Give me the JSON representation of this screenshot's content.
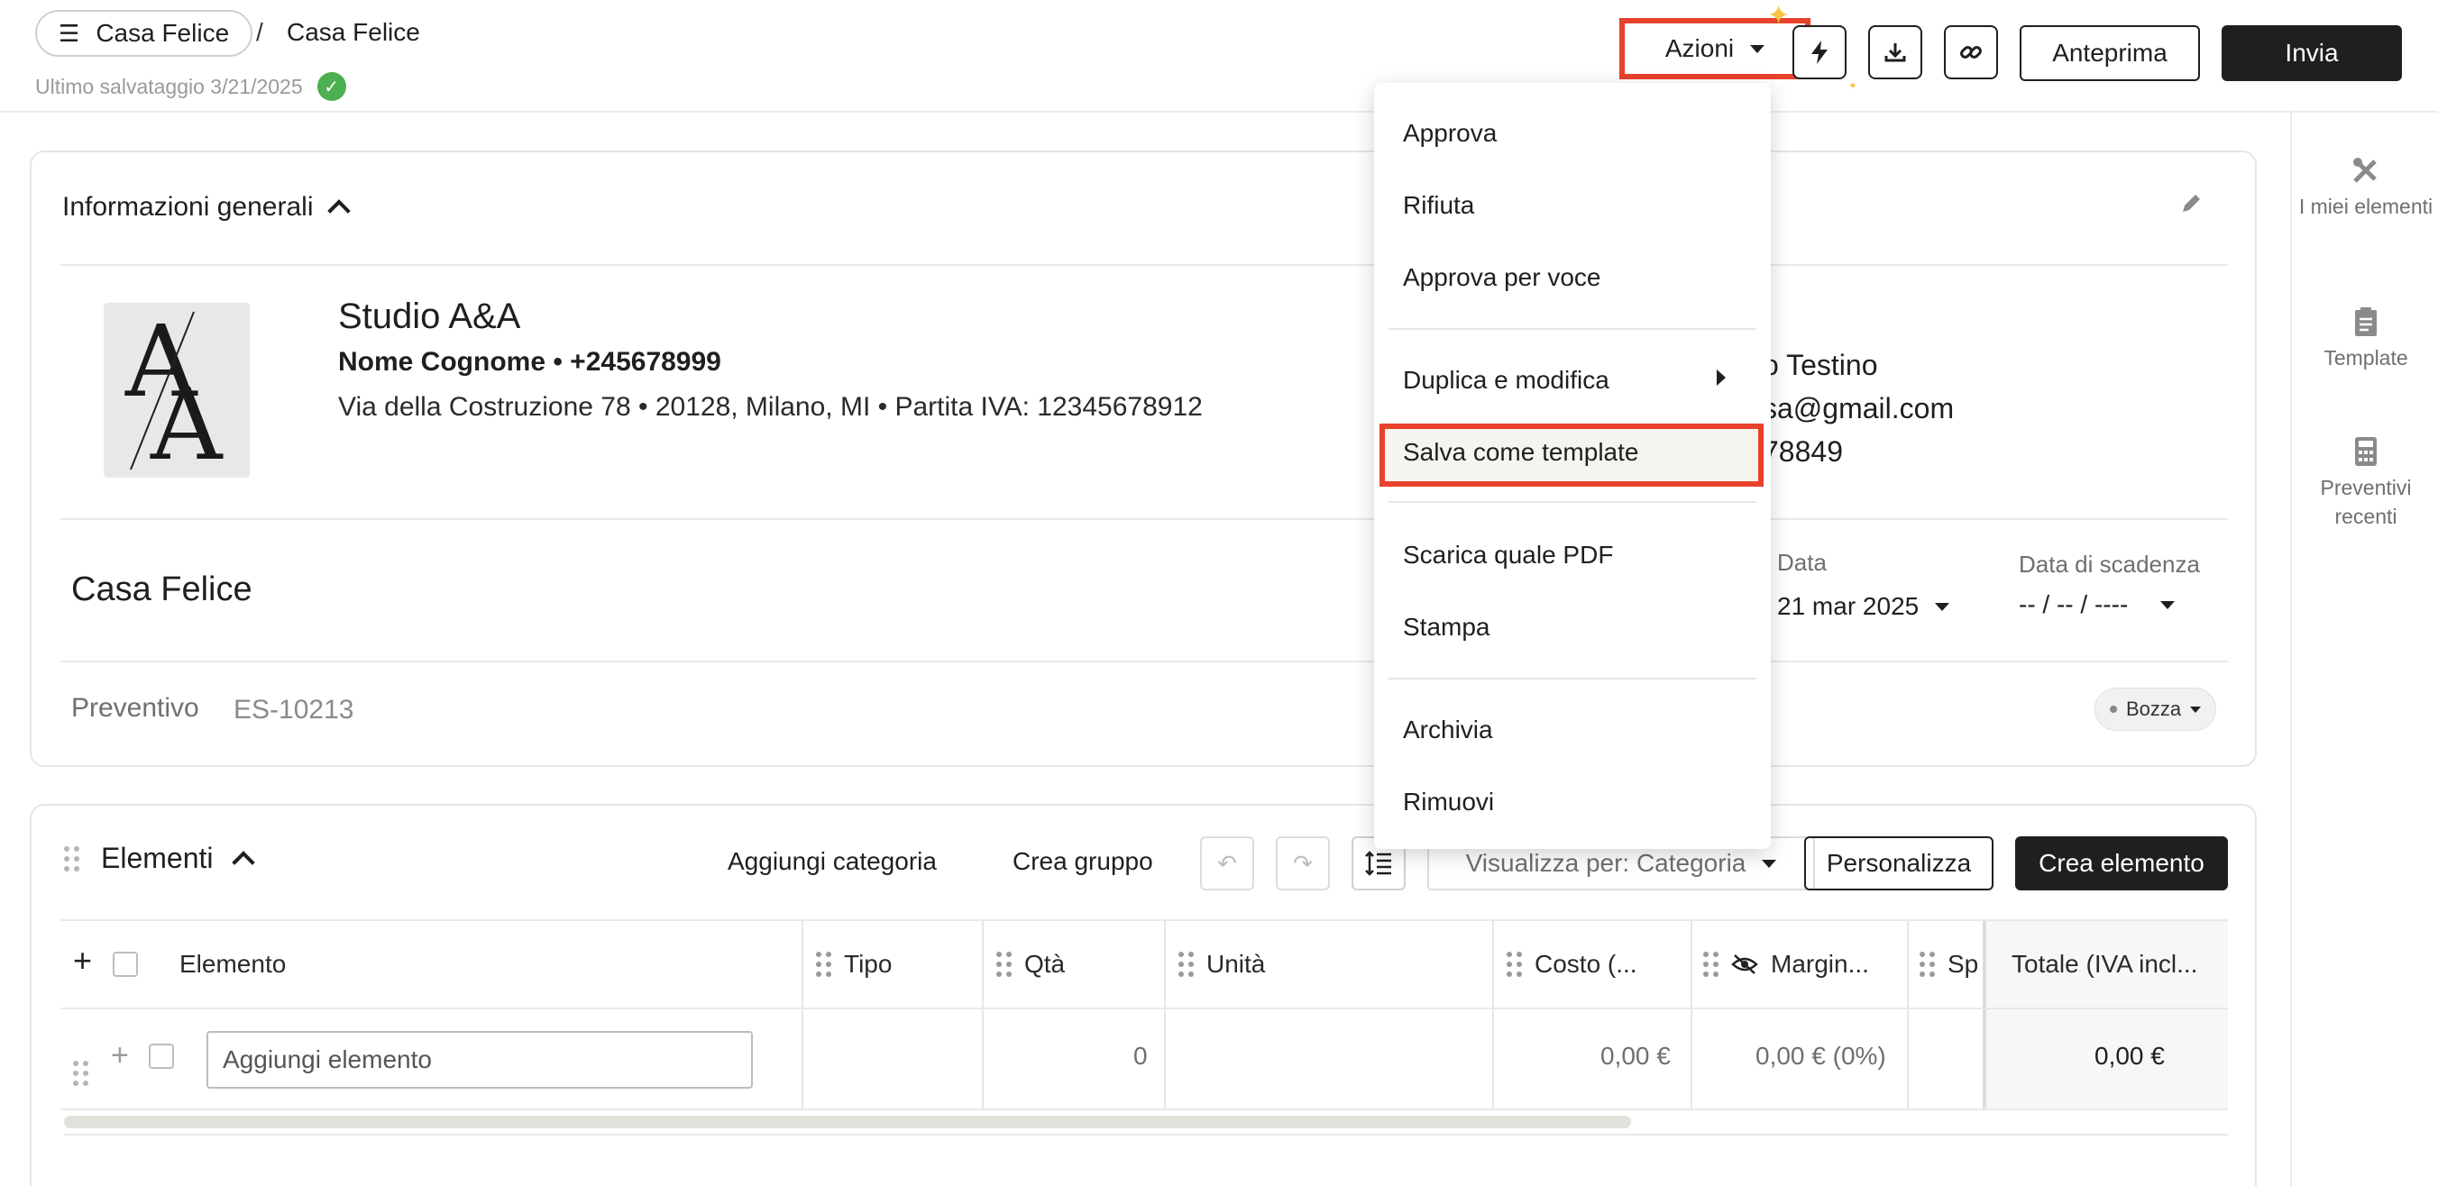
{
  "header": {
    "project_button": "Casa Felice",
    "breadcrumb_sep": "/",
    "breadcrumb_current": "Casa Felice",
    "last_saved": "Ultimo salvataggio 3/21/2025",
    "actions_label": "Azioni",
    "preview_label": "Anteprima",
    "send_label": "Invia",
    "icons": [
      "lightning-icon",
      "download-icon",
      "link-icon"
    ]
  },
  "sidebar": {
    "items": [
      {
        "label": "I miei elementi",
        "icon": "tools-icon"
      },
      {
        "label": "Template",
        "icon": "clipboard-icon"
      },
      {
        "label": "Preventivi recenti",
        "icon": "calculator-icon"
      }
    ]
  },
  "info": {
    "title": "Informazioni generali",
    "logo_text": "A/A",
    "company": "Studio A&A",
    "contact": "Nome Cognome  •  +245678999",
    "address": "Via della Costruzione 78  •  20128, Milano, MI  •  Partita IVA: 12345678912",
    "client_name": "o Testino",
    "client_email": "sa@gmail.com",
    "client_phone": "78849",
    "project_name": "Casa Felice",
    "date_label": "Data",
    "date_value": "21 mar 2025",
    "due_label": "Data di scadenza",
    "due_value": "-- / -- / ----",
    "quote_label": "Preventivo",
    "quote_number": "ES-10213",
    "status": "Bozza"
  },
  "elements": {
    "title": "Elementi",
    "add_category": "Aggiungi categoria",
    "create_group": "Crea gruppo",
    "view_by": "Visualizza per: Categoria",
    "customize": "Personalizza",
    "create_element": "Crea elemento",
    "columns": [
      "Elemento",
      "Tipo",
      "Qtà",
      "Unità",
      "Costo (...",
      "Margin...",
      "Sp",
      "Totale (IVA incl..."
    ],
    "row": {
      "placeholder": "Aggiungi elemento",
      "qty": "0",
      "cost": "0,00 €",
      "margin": "0,00 € (0%)",
      "total": "0,00 €"
    }
  },
  "menu": {
    "items": [
      "Approva",
      "Rifiuta",
      "Approva per voce",
      "Duplica e modifica",
      "Salva come template",
      "Scarica quale PDF",
      "Stampa",
      "Archivia",
      "Rimuovi"
    ],
    "highlighted": "Salva come template"
  },
  "colors": {
    "accent_red": "#e8412c",
    "dark": "#1f1f1f",
    "success": "#4caf50"
  }
}
